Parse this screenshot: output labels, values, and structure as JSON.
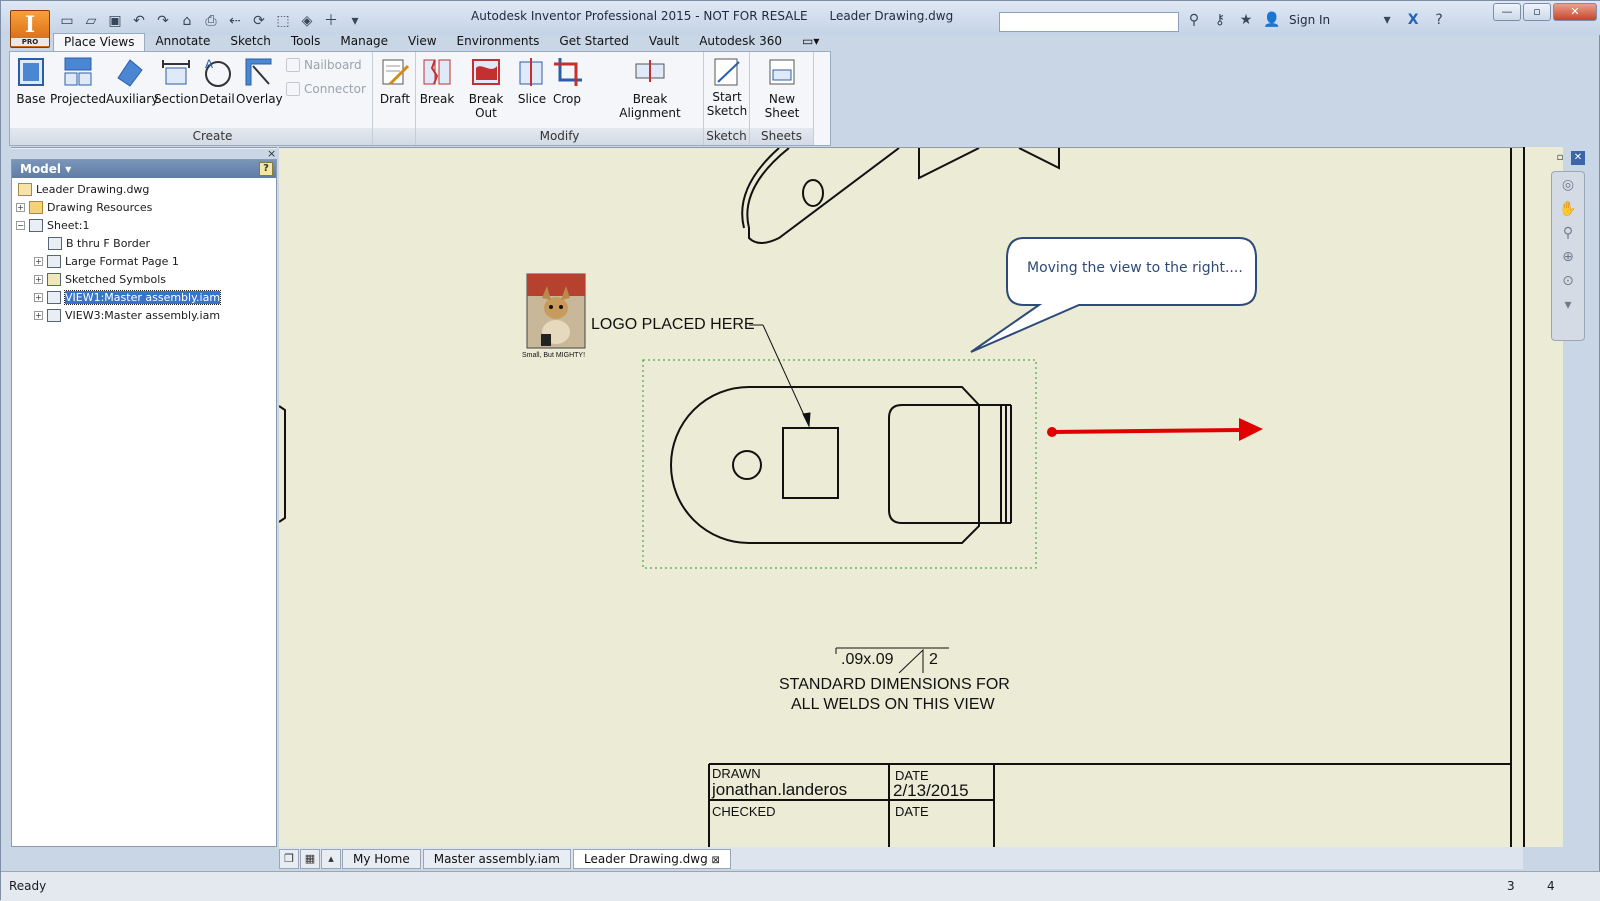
{
  "app": {
    "logo_letter": "I",
    "logo_sub": "PRO",
    "title_main": "Autodesk Inventor Professional 2015 - NOT FOR RESALE",
    "title_file": "Leader Drawing.dwg",
    "sign_in": "Sign In"
  },
  "ribbon": {
    "tabs": [
      "Place Views",
      "Annotate",
      "Sketch",
      "Tools",
      "Manage",
      "View",
      "Environments",
      "Get Started",
      "Vault",
      "Autodesk 360"
    ],
    "create": {
      "title": "Create",
      "buttons": [
        "Base",
        "Projected",
        "Auxiliary",
        "Section",
        "Detail",
        "Overlay"
      ],
      "small": [
        "Nailboard",
        "Connector"
      ]
    },
    "draft": "Draft",
    "modify": {
      "title": "Modify",
      "buttons": [
        "Break",
        "Break Out",
        "Slice",
        "Crop",
        "Break Alignment"
      ]
    },
    "sketch": {
      "title": "Sketch",
      "button_line1": "Start",
      "button_line2": "Sketch"
    },
    "sheets": {
      "title": "Sheets",
      "button": "New Sheet"
    }
  },
  "browser": {
    "header": "Model",
    "help": "?",
    "close": "×",
    "items": [
      "Leader Drawing.dwg",
      "Drawing Resources",
      "Sheet:1",
      "B thru F Border",
      "Large Format Page 1",
      "Sketched Symbols",
      "VIEW1:Master assembly.iam",
      "VIEW3:Master assembly.iam"
    ]
  },
  "drawing": {
    "logo_caption": "Small, But MIGHTY!",
    "leader_text": "LOGO PLACED HERE",
    "callout": "Moving the view to the right....",
    "weld_value": ".09x.09",
    "weld_count": "2",
    "note_line1": "STANDARD DIMENSIONS FOR",
    "note_line2": "ALL WELDS ON THIS VIEW",
    "title_block": {
      "drawn_label": "DRAWN",
      "drawn_by": "jonathan.landeros",
      "date_label": "DATE",
      "date_value": "2/13/2015",
      "checked_label": "CHECKED",
      "date_label2": "DATE"
    }
  },
  "doc_tabs": [
    "My Home",
    "Master assembly.iam",
    "Leader Drawing.dwg"
  ],
  "status": {
    "text": "Ready",
    "cell1": "3",
    "cell2": "4"
  },
  "colors": {
    "accent_arrow": "#e00000",
    "canvas": "#ebebd6",
    "callout_border": "#2d4a78"
  }
}
